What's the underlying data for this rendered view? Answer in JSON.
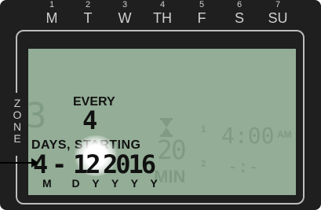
{
  "days": [
    {
      "num": "1",
      "label": "M"
    },
    {
      "num": "2",
      "label": "T"
    },
    {
      "num": "3",
      "label": "W"
    },
    {
      "num": "4",
      "label": "TH"
    },
    {
      "num": "5",
      "label": "F"
    },
    {
      "num": "6",
      "label": "S"
    },
    {
      "num": "7",
      "label": "SU"
    }
  ],
  "zone": [
    "Z",
    "O",
    "N",
    "E"
  ],
  "display": {
    "zone_digit": "3",
    "every_label": "EVERY",
    "interval_value": "4",
    "days_starting_label": "DAYS, STARTING",
    "date_month": "4",
    "date_dash": "-",
    "date_day": "12",
    "date_year": "2016",
    "date_format": "M  D Y Y Y Y",
    "duration_value": "20",
    "duration_unit": "MIN",
    "hourglass_icon": "hourglass-icon",
    "start1_label": "1",
    "start1_time": "4:00",
    "start1_ampm": "AM",
    "start2_label": "2",
    "start2_time": "-:-"
  }
}
